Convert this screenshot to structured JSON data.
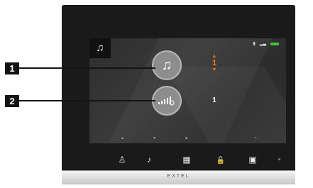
{
  "device": {
    "brand": "EXTEL",
    "screen": {
      "mode_icon": "music-note-icon",
      "status": {
        "icons": [
          "sd-card-icon",
          "signal-icon",
          "battery-icon"
        ],
        "battery_color": "#3ec43e"
      },
      "ringtone_button_icon": "music-note-icon",
      "ringtone_value": "1",
      "ringtone_up_arrow": "▲",
      "ringtone_down_arrow": "▼",
      "volume_button_icon": "volume-bars-icon",
      "volume_value": "1",
      "nav_hints": [
        "▲",
        "▼",
        "■",
        "↖"
      ],
      "accent_color": "#ff7a00"
    },
    "physical_buttons": [
      {
        "name": "user-button",
        "icon": "user-icon",
        "glyph": "♙"
      },
      {
        "name": "ringtone-button",
        "icon": "music-bell-icon",
        "glyph": "♪"
      },
      {
        "name": "menu-button",
        "icon": "grid-icon",
        "glyph": "▦"
      },
      {
        "name": "unlock-button",
        "icon": "padlock-icon",
        "glyph": "🔓"
      },
      {
        "name": "camera-button",
        "icon": "camera-icon",
        "glyph": "▣"
      }
    ]
  },
  "callouts": [
    {
      "label": "1"
    },
    {
      "label": "2"
    }
  ]
}
